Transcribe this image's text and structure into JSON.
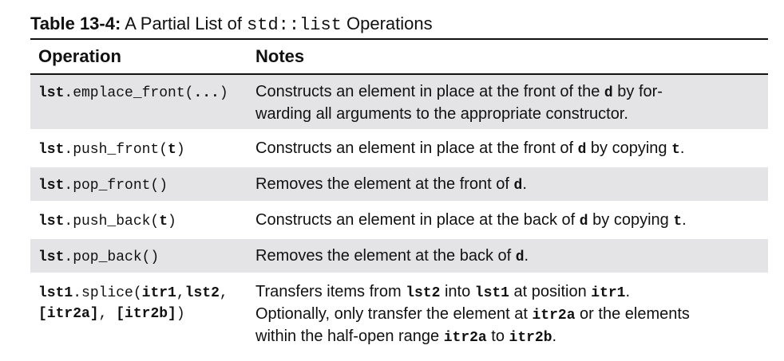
{
  "caption": {
    "label": "Table 13-4:",
    "pre": " A Partial List of ",
    "code": "std::list",
    "post": " Operations"
  },
  "headers": {
    "operation": "Operation",
    "notes": "Notes"
  },
  "rows": [
    {
      "op": [
        {
          "t": "lst",
          "b": true
        },
        {
          "t": ".emplace_front("
        },
        {
          "t": "...",
          "b": true
        },
        {
          "t": ")"
        }
      ],
      "notes": [
        {
          "t": "Constructs an element in place at the front of the "
        },
        {
          "t": "d",
          "code": true,
          "b": true
        },
        {
          "t": " by for-"
        },
        {
          "br": true
        },
        {
          "t": "warding all arguments to the appropriate constructor."
        }
      ]
    },
    {
      "op": [
        {
          "t": "lst",
          "b": true
        },
        {
          "t": ".push_front("
        },
        {
          "t": "t",
          "b": true
        },
        {
          "t": ")"
        }
      ],
      "notes": [
        {
          "t": "Constructs an element in place at the front of "
        },
        {
          "t": "d",
          "code": true,
          "b": true
        },
        {
          "t": " by copying "
        },
        {
          "t": "t",
          "code": true,
          "b": true
        },
        {
          "t": "."
        }
      ]
    },
    {
      "op": [
        {
          "t": "lst",
          "b": true
        },
        {
          "t": ".pop_front()"
        }
      ],
      "notes": [
        {
          "t": "Removes the element at the front of "
        },
        {
          "t": "d",
          "code": true,
          "b": true
        },
        {
          "t": "."
        }
      ]
    },
    {
      "op": [
        {
          "t": "lst",
          "b": true
        },
        {
          "t": ".push_back("
        },
        {
          "t": "t",
          "b": true
        },
        {
          "t": ")"
        }
      ],
      "notes": [
        {
          "t": "Constructs an element in place at the back of "
        },
        {
          "t": "d",
          "code": true,
          "b": true
        },
        {
          "t": " by copying "
        },
        {
          "t": "t",
          "code": true,
          "b": true
        },
        {
          "t": "."
        }
      ]
    },
    {
      "op": [
        {
          "t": "lst",
          "b": true
        },
        {
          "t": ".pop_back()"
        }
      ],
      "notes": [
        {
          "t": "Removes the element at the back of "
        },
        {
          "t": "d",
          "code": true,
          "b": true
        },
        {
          "t": "."
        }
      ]
    },
    {
      "op": [
        {
          "t": "lst1",
          "b": true
        },
        {
          "t": ".splice("
        },
        {
          "t": "itr1",
          "b": true
        },
        {
          "t": ","
        },
        {
          "t": "lst2",
          "b": true
        },
        {
          "t": ","
        },
        {
          "br": true
        },
        {
          "t": "[itr2a]",
          "b": true
        },
        {
          "t": ", "
        },
        {
          "t": "[itr2b]",
          "b": true
        },
        {
          "t": ")"
        }
      ],
      "notes": [
        {
          "t": "Transfers items from "
        },
        {
          "t": "lst2",
          "code": true,
          "b": true
        },
        {
          "t": " into "
        },
        {
          "t": "lst1",
          "code": true,
          "b": true
        },
        {
          "t": " at position "
        },
        {
          "t": "itr1",
          "code": true,
          "b": true
        },
        {
          "t": "."
        },
        {
          "br": true
        },
        {
          "t": "Optionally, only transfer the element at "
        },
        {
          "t": "itr2a",
          "code": true,
          "b": true
        },
        {
          "t": " or the elements"
        },
        {
          "br": true
        },
        {
          "t": "within the half-open range "
        },
        {
          "t": "itr2a",
          "code": true,
          "b": true
        },
        {
          "t": " to "
        },
        {
          "t": "itr2b",
          "code": true,
          "b": true
        },
        {
          "t": "."
        }
      ]
    }
  ]
}
